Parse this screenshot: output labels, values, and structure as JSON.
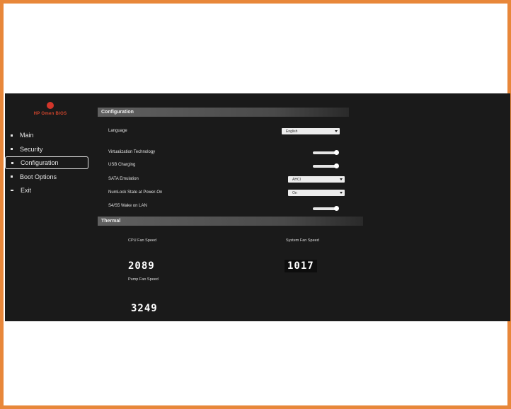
{
  "brand": {
    "logo_text": "HP Omen BIOS"
  },
  "sidebar": {
    "items": [
      {
        "label": "Main",
        "marker": "bullet"
      },
      {
        "label": "Security",
        "marker": "bullet"
      },
      {
        "label": "Configuration",
        "marker": "bullet",
        "active": true
      },
      {
        "label": "Boot Options",
        "marker": "bullet"
      },
      {
        "label": "Exit",
        "marker": "dash"
      }
    ]
  },
  "configuration": {
    "header": "Configuration",
    "language": {
      "label": "Language",
      "value": "English"
    },
    "virtualization": {
      "label": "Virtualization Technology",
      "state": "on"
    },
    "lan_wake": {
      "label": "USB Charging",
      "state": "on"
    },
    "sata_emulation": {
      "label": "SATA Emulation",
      "value": "AHCI"
    },
    "numlock": {
      "label": "NumLock State at Power-On",
      "value": "On"
    },
    "s4_s5_wake": {
      "label": "S4/S5 Wake on LAN",
      "state": "on"
    }
  },
  "thermal": {
    "header": "Thermal",
    "cpu_fan": {
      "label": "CPU Fan Speed",
      "value": "2089"
    },
    "system_fan": {
      "label": "System Fan Speed",
      "value": "1017"
    },
    "pump_fan": {
      "label": "Pump Fan Speed",
      "value": "3249"
    }
  },
  "colors": {
    "frame_border": "#e8873a",
    "accent_red": "#d2452c",
    "screen_bg": "#1a1a1a"
  }
}
